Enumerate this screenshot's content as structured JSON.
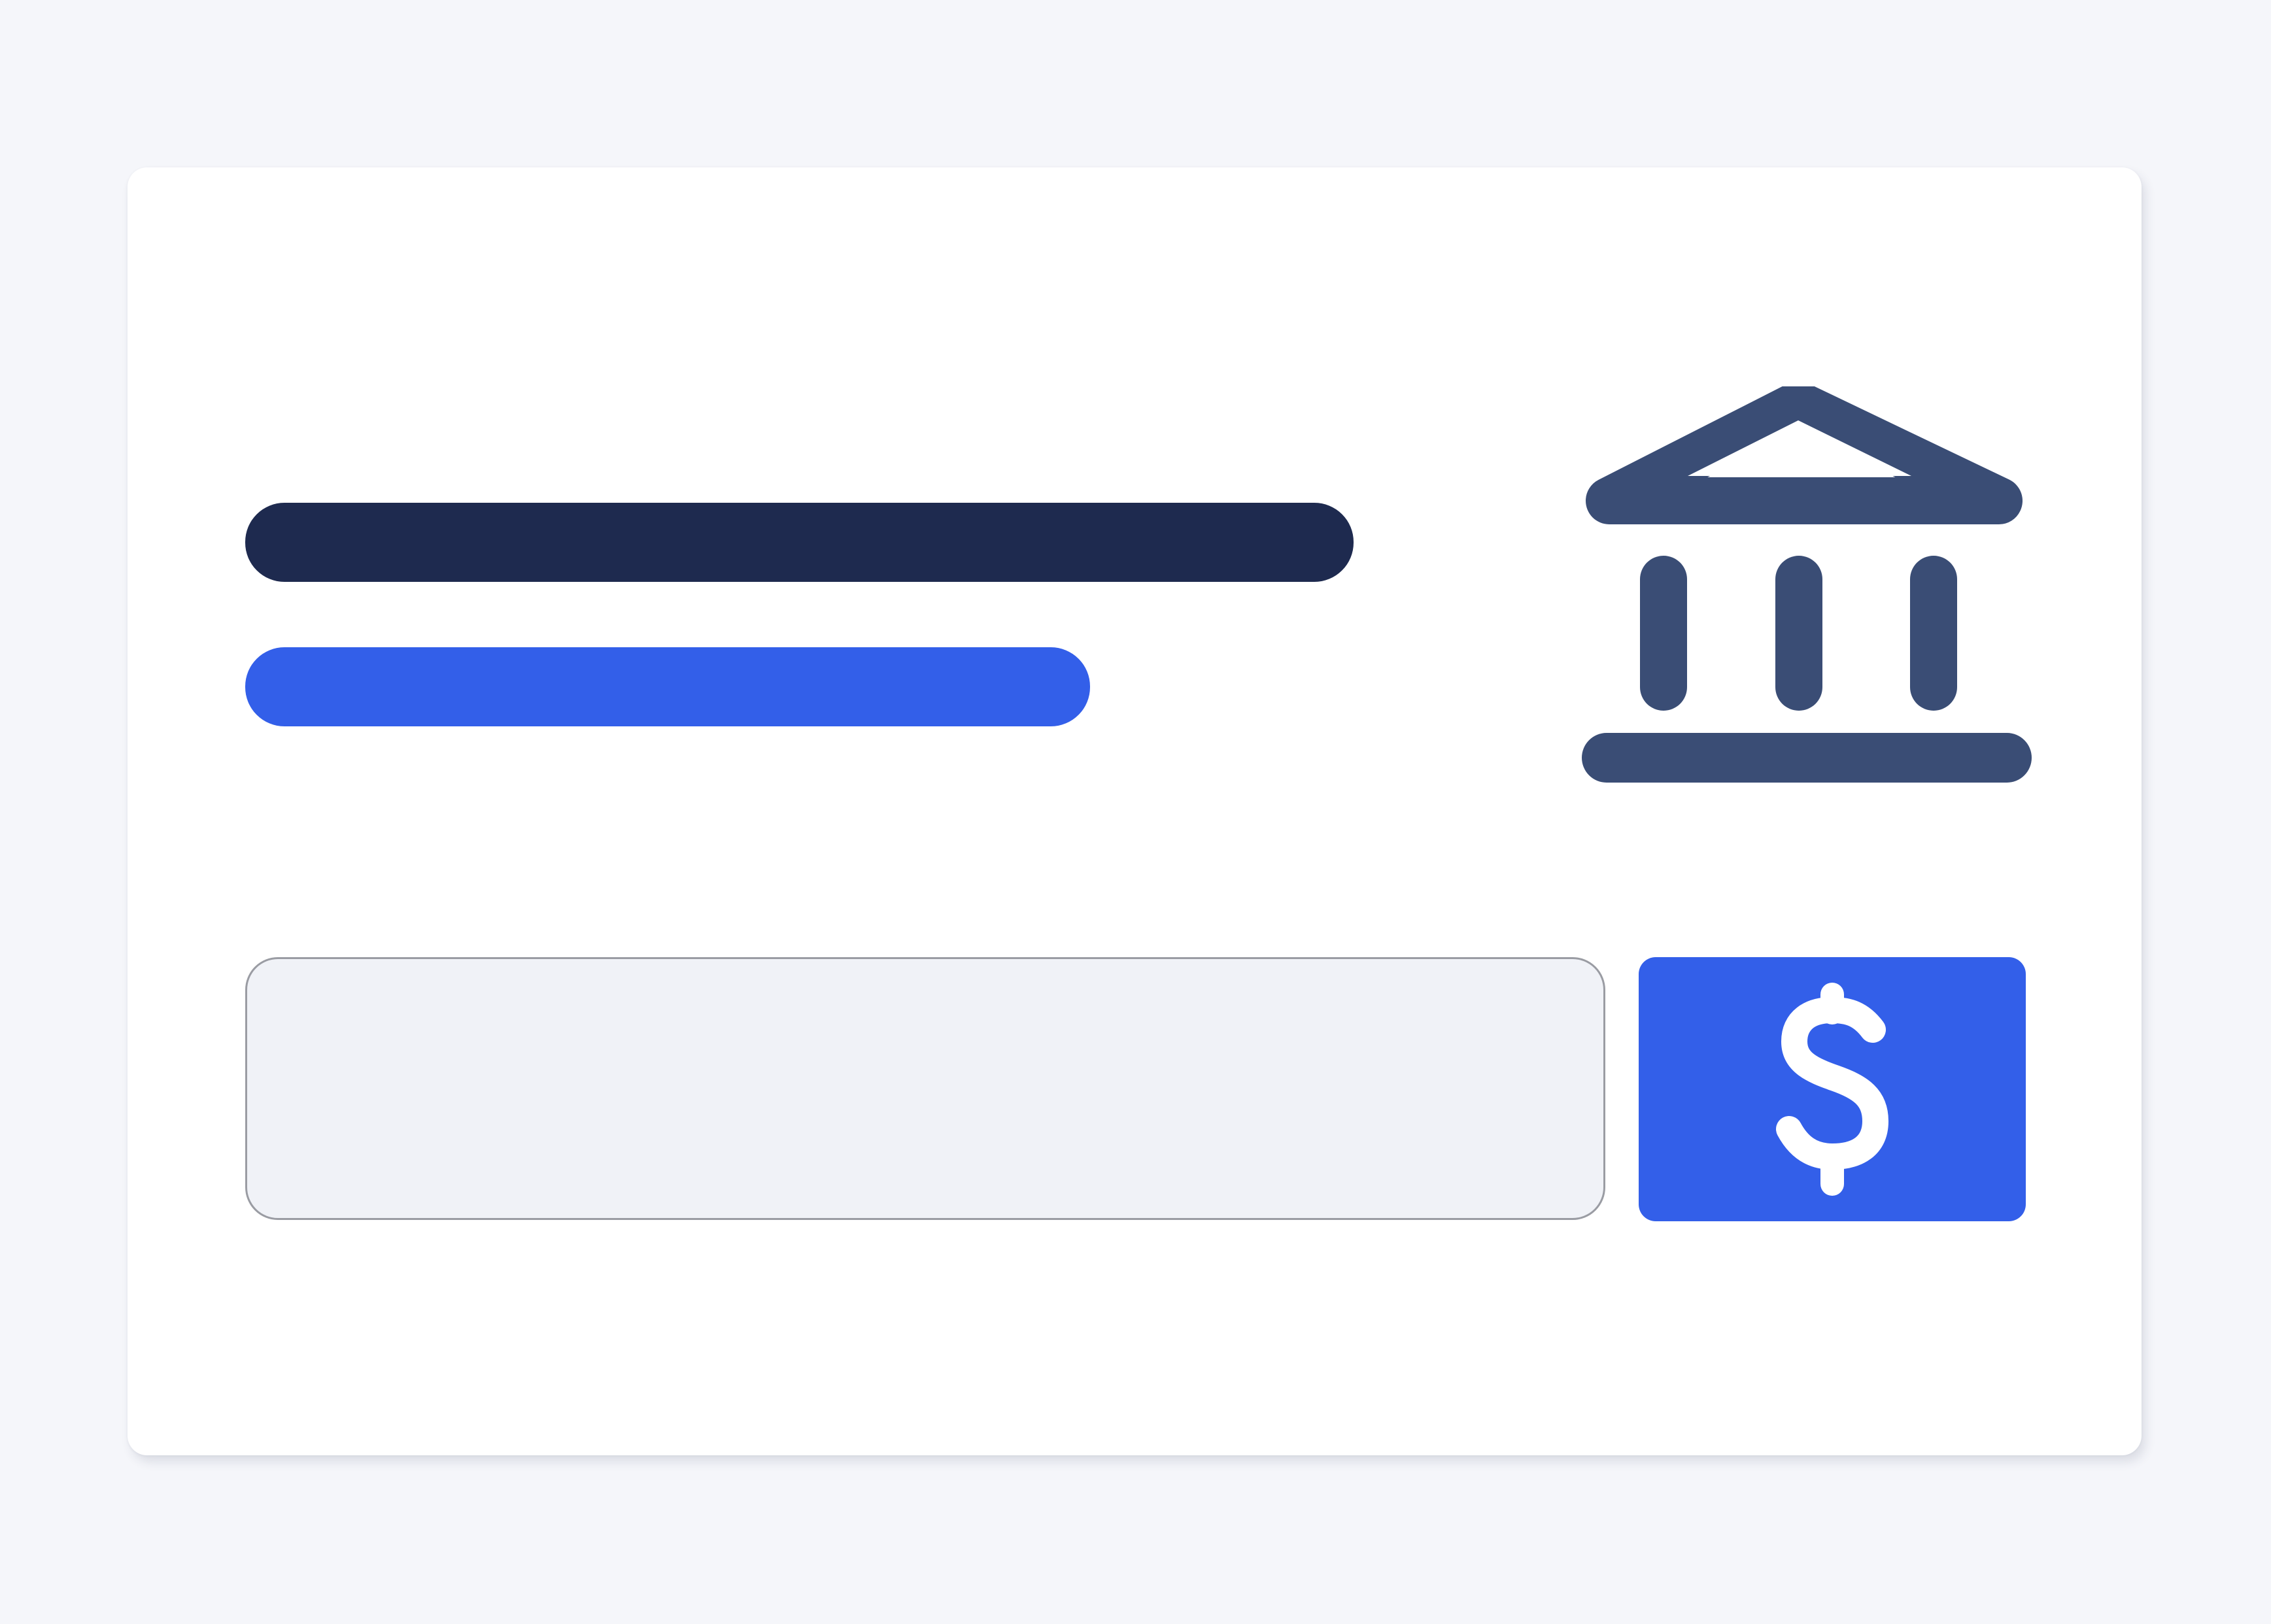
{
  "colors": {
    "background": "#f5f6fa",
    "card": "#ffffff",
    "title_bar": "#1e2a4f",
    "subtitle_bar": "#335fe9",
    "bank_icon": "#3a4d75",
    "input_fill": "#f0f2f7",
    "input_border": "#9a9ca3",
    "button": "#335fe9",
    "button_icon": "#ffffff"
  },
  "card": {
    "title_placeholder": "",
    "subtitle_placeholder": "",
    "bank_icon": "bank-icon"
  },
  "amount_input": {
    "value": "",
    "placeholder": ""
  },
  "pay_button": {
    "icon": "dollar-icon",
    "label": ""
  }
}
